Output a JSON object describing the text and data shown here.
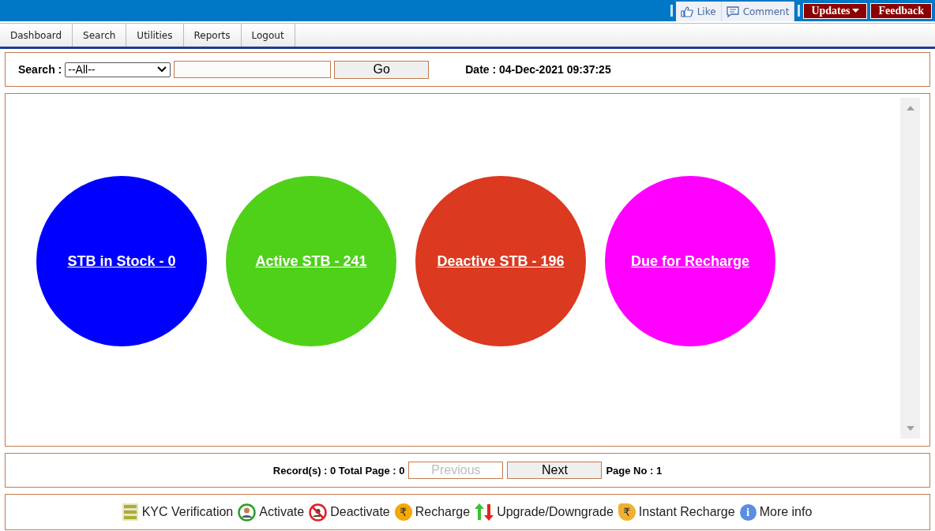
{
  "top_bar": {
    "social": [
      {
        "kind": "like",
        "label": "Like"
      },
      {
        "kind": "comment",
        "label": "Comment"
      }
    ],
    "buttons": [
      {
        "label": "Updates",
        "dropdown": true
      },
      {
        "label": "Feedback",
        "dropdown": false
      }
    ]
  },
  "menu": [
    "Dashboard",
    "Search",
    "Utilities",
    "Reports",
    "Logout"
  ],
  "search": {
    "label": "Search :",
    "select_value": "--All--",
    "button": "Go",
    "date": "Date : 04-Dec-2021 09:37:25"
  },
  "circles": [
    {
      "label": "STB in Stock - 0",
      "color": "#0000ff"
    },
    {
      "label": "Active STB - 241",
      "color": "#4fd11a"
    },
    {
      "label": "Deactive STB - 196",
      "color": "#db3920"
    },
    {
      "label": "Due for Recharge",
      "color": "#ff00ff"
    }
  ],
  "pager": {
    "records": "Record(s) : 0 Total Page : 0",
    "buttons": [
      {
        "label": "Previous",
        "disabled": true
      },
      {
        "label": "Next",
        "disabled": false
      }
    ],
    "page_no": "Page No : 1"
  },
  "legend": [
    {
      "kind": "kyc",
      "label": "KYC Verification"
    },
    {
      "kind": "activate",
      "label": "Activate"
    },
    {
      "kind": "deactivate",
      "label": "Deactivate"
    },
    {
      "kind": "recharge",
      "label": "Recharge",
      "glyph": "₹"
    },
    {
      "kind": "updown",
      "label": "Upgrade/Downgrade"
    },
    {
      "kind": "instant",
      "label": "Instant Recharge",
      "glyph": "₹"
    },
    {
      "kind": "info",
      "label": "More info",
      "glyph": "i"
    }
  ]
}
